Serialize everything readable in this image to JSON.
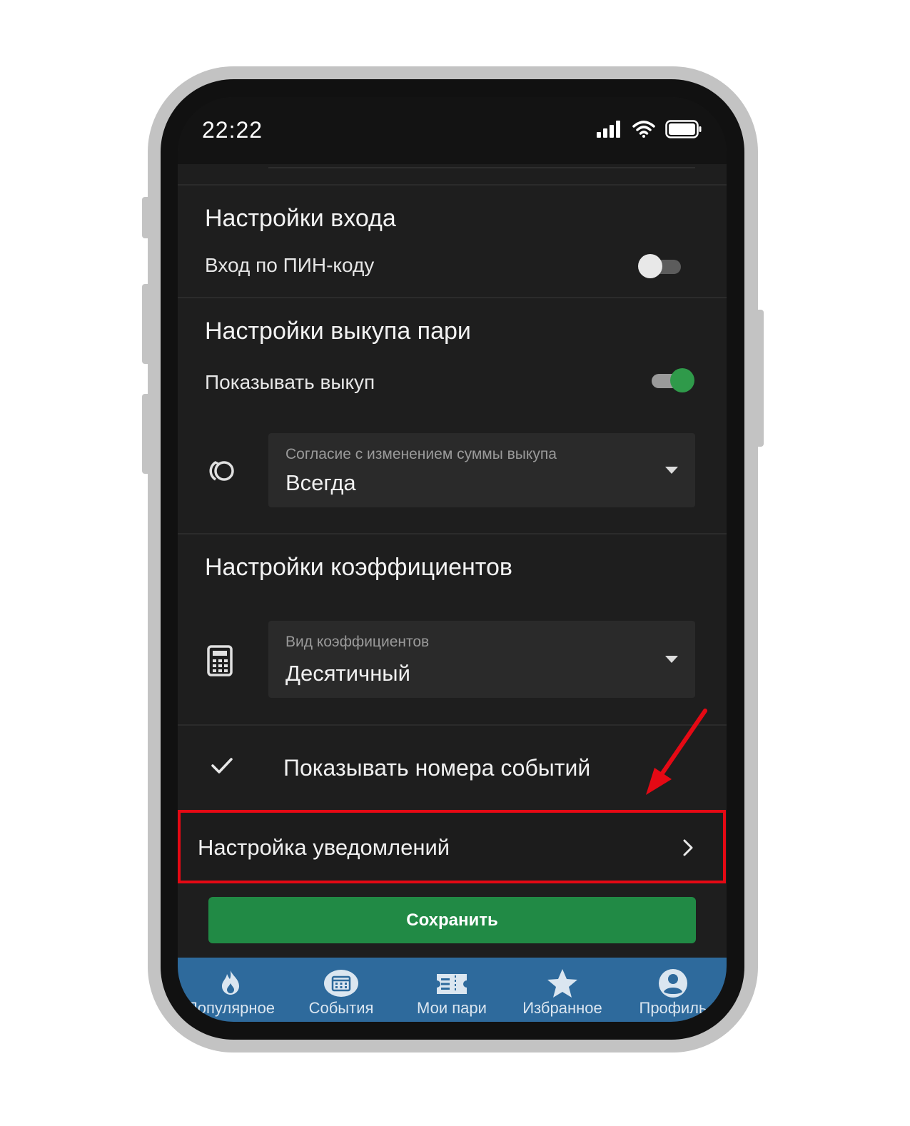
{
  "status_bar": {
    "time": "22:22",
    "icons": [
      "signal-icon",
      "wifi-icon",
      "battery-icon"
    ]
  },
  "login_settings": {
    "title": "Настройки входа",
    "pin_login": {
      "label": "Вход по ПИН-коду",
      "enabled": false
    }
  },
  "cashout_settings": {
    "title": "Настройки выкупа пари",
    "show_cashout": {
      "label": "Показывать выкуп",
      "enabled": true
    },
    "consent_dropdown": {
      "label": "Согласие с изменением суммы выкупа",
      "value": "Всегда",
      "icon": "cashout-cycle-icon"
    }
  },
  "odds_settings": {
    "title": "Настройки коэффициентов",
    "odds_format_dropdown": {
      "label": "Вид коэффициентов",
      "value": "Десятичный",
      "icon": "calculator-icon"
    }
  },
  "show_event_numbers": {
    "label": "Показывать номера событий",
    "checked": true
  },
  "notification_settings": {
    "label": "Настройка уведомлений"
  },
  "save_button": {
    "label": "Сохранить"
  },
  "bottom_nav": {
    "items": [
      {
        "label": "Популярное",
        "icon": "flame-icon"
      },
      {
        "label": "События",
        "icon": "calendar-icon"
      },
      {
        "label": "Мои пари",
        "icon": "ticket-icon"
      },
      {
        "label": "Избранное",
        "icon": "star-icon"
      },
      {
        "label": "Профиль",
        "icon": "profile-icon"
      }
    ]
  },
  "colors": {
    "screen_background": "#1e1e1e",
    "accent_green": "#218a45",
    "nav_blue": "#2e6a9c",
    "highlight_red": "#e50914"
  }
}
